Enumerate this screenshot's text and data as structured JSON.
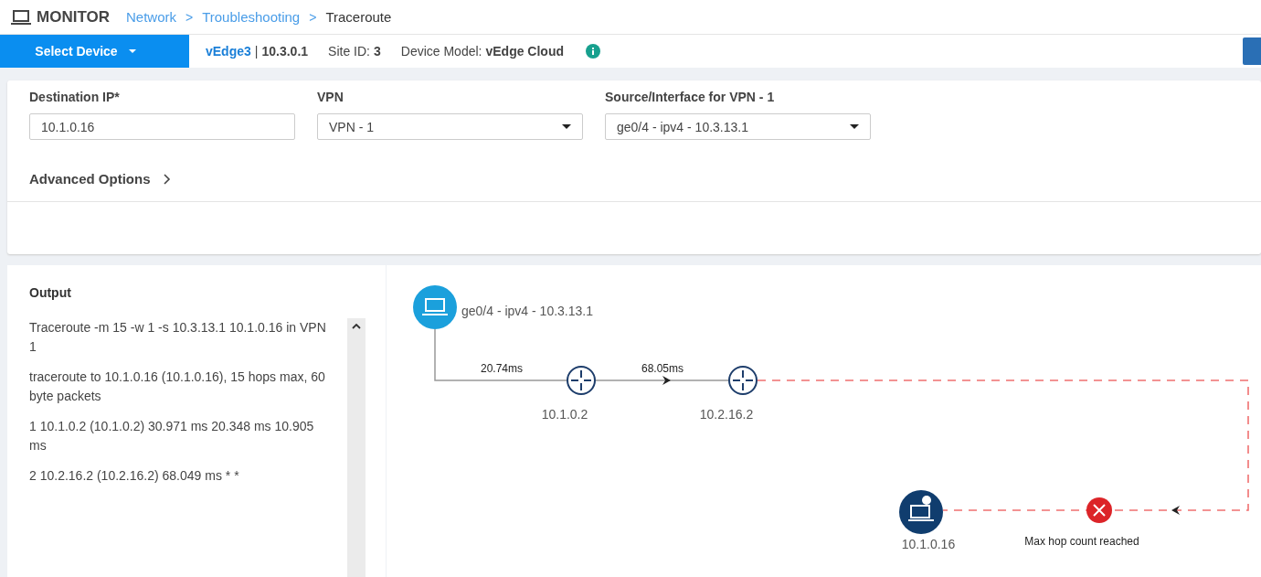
{
  "header": {
    "title": "MONITOR",
    "breadcrumb_separator": ">",
    "breadcrumb": [
      {
        "label": "Network",
        "link": true
      },
      {
        "label": "Troubleshooting",
        "link": true
      },
      {
        "label": "Traceroute",
        "link": false
      }
    ]
  },
  "device_bar": {
    "select_label": "Select Device",
    "device_name": "vEdge3",
    "name_separator": "|",
    "device_ip": "10.3.0.1",
    "site_label": "Site ID:",
    "site_id": "3",
    "model_label": "Device Model:",
    "model": "vEdge Cloud"
  },
  "form": {
    "fields": [
      {
        "label": "Destination IP*",
        "value": "10.1.0.16",
        "kind": "text"
      },
      {
        "label": "VPN",
        "value": "VPN - 1",
        "kind": "select"
      },
      {
        "label": "Source/Interface for VPN - 1",
        "value": "ge0/4 - ipv4 - 10.3.13.1",
        "kind": "select"
      }
    ],
    "advanced_options": {
      "label": "Advanced Options",
      "expanded": false
    }
  },
  "output": {
    "title": "Output",
    "lines": [
      "Traceroute -m 15 -w 1 -s 10.3.13.1 10.1.0.16 in VPN 1",
      "traceroute to 10.1.0.16 (10.1.0.16), 15 hops max, 60 byte packets",
      "1 10.1.0.2 (10.1.0.2) 30.971 ms 20.348 ms 10.905 ms",
      "2 10.2.16.2 (10.2.16.2) 68.049 ms * *"
    ]
  },
  "diagram": {
    "source": {
      "label": "ge0/4 - ipv4 - 10.3.13.1"
    },
    "hops": [
      {
        "label": "10.1.0.2",
        "latency": "20.74ms"
      },
      {
        "label": "10.2.16.2",
        "latency": "68.05ms"
      }
    ],
    "destination": {
      "label": "10.1.0.16",
      "reached": false
    },
    "error_message": "Max hop count reached"
  }
}
